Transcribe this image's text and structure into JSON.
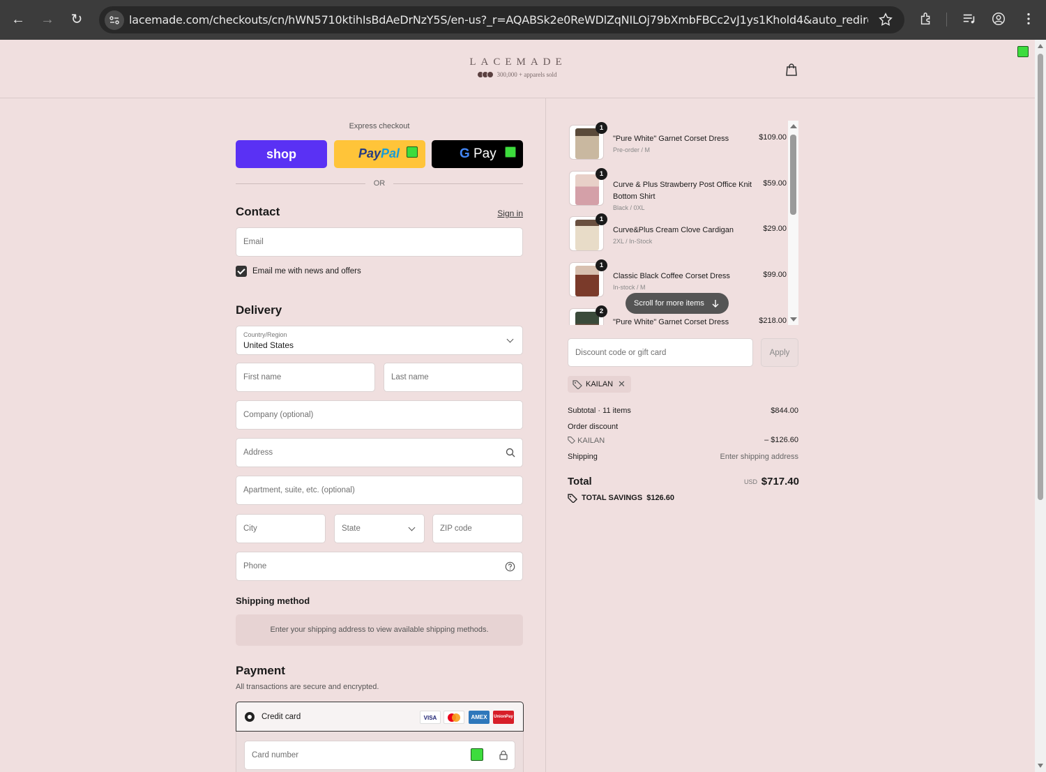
{
  "browser": {
    "url": "lacemade.com/checkouts/cn/hWN5710ktihIsBdAeDrNzY5S/en-us?_r=AQABSk2e0ReWDlZqNILOj79bXmbFBCc2vJ1ys1Khold4&auto_redirect=fals..."
  },
  "header": {
    "logo_word": "LACEMADE",
    "logo_sub": "300,000 + apparels sold"
  },
  "express": {
    "title": "Express checkout",
    "shop_label": "shop",
    "paypal_label_1": "Pay",
    "paypal_label_2": "Pal",
    "gpay_g": "G",
    "gpay_label": "Pay",
    "or_label": "OR"
  },
  "contact": {
    "title": "Contact",
    "signin": "Sign in",
    "email_placeholder": "Email",
    "newsletter_label": "Email me with news and offers"
  },
  "delivery": {
    "title": "Delivery",
    "country_label": "Country/Region",
    "country_value": "United States",
    "first_name": "First name",
    "last_name": "Last name",
    "company": "Company (optional)",
    "address": "Address",
    "apartment": "Apartment, suite, etc. (optional)",
    "city": "City",
    "state": "State",
    "zip": "ZIP code",
    "phone": "Phone"
  },
  "shipping": {
    "title": "Shipping method",
    "message": "Enter your shipping address to view available shipping methods."
  },
  "payment": {
    "title": "Payment",
    "subtitle": "All transactions are secure and encrypted.",
    "credit_card_label": "Credit card",
    "card_logos": [
      "VISA",
      "",
      "AMEX",
      "UnionPay"
    ],
    "card_number_placeholder": "Card number"
  },
  "cart": {
    "items": [
      {
        "qty": "1",
        "name": "\"Pure White\" Garnet Corset Dress",
        "variant": "Pre-order / M",
        "price": "$109.00",
        "color": "#c9b8a0"
      },
      {
        "qty": "1",
        "name": "Curve & Plus Strawberry Post Office Knit Bottom Shirt",
        "variant": "Black / 0XL",
        "price": "$59.00",
        "color": "#d4a0a8"
      },
      {
        "qty": "1",
        "name": "Curve&Plus Cream Clove Cardigan",
        "variant": "2XL / In-Stock",
        "price": "$29.00",
        "color": "#e8dcc8"
      },
      {
        "qty": "1",
        "name": "Classic Black Coffee Corset Dress",
        "variant": "In-stock / M",
        "price": "$99.00",
        "color": "#7a3a2a"
      },
      {
        "qty": "2",
        "name": "\"Pure White\" Garnet Corset Dress",
        "variant": "",
        "price": "$218.00",
        "color": "#6a5040"
      }
    ],
    "scroll_hint": "Scroll for more items"
  },
  "discount": {
    "placeholder": "Discount code or gift card",
    "apply_label": "Apply",
    "applied_code": "KAILAN"
  },
  "summary": {
    "subtotal_label": "Subtotal · 11 items",
    "subtotal_value": "$844.00",
    "order_discount_label": "Order discount",
    "discount_code": "KAILAN",
    "discount_value": "– $126.60",
    "shipping_label": "Shipping",
    "shipping_value": "Enter shipping address",
    "total_label": "Total",
    "currency": "USD",
    "total_value": "$717.40",
    "savings_label": "TOTAL SAVINGS",
    "savings_value": "$126.60"
  },
  "colors": {
    "page_bg": "#f0dfdf",
    "shop_purple": "#5a31f4",
    "paypal_yellow": "#ffc439",
    "marker_green": "#3ddc3d"
  }
}
